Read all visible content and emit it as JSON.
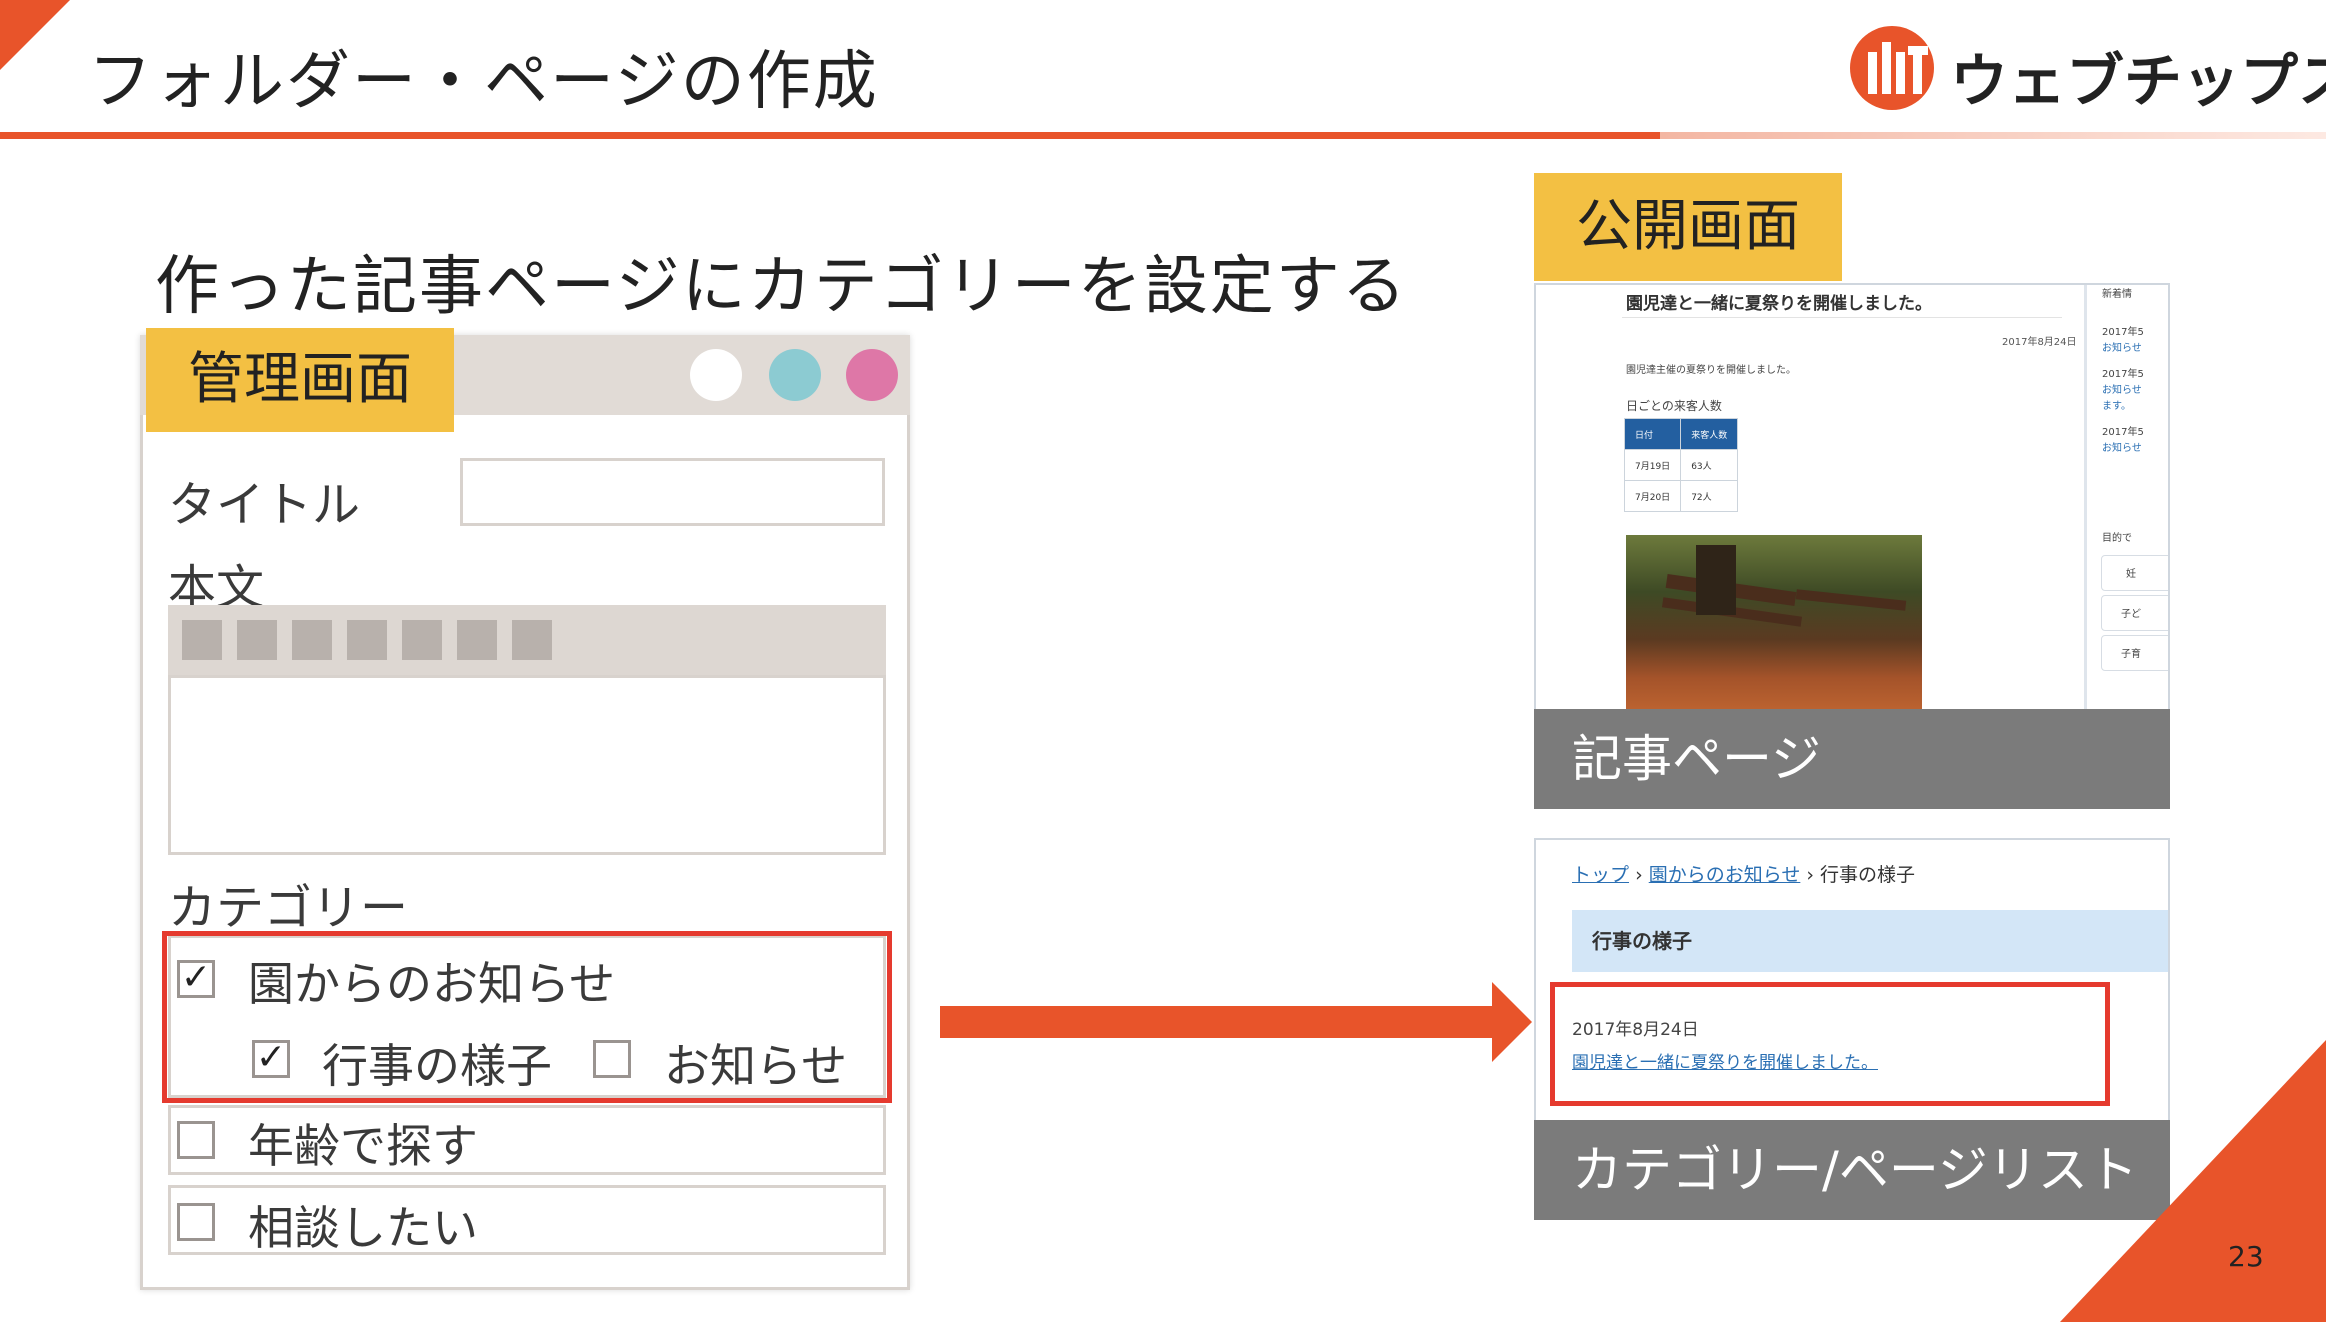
{
  "header": {
    "title": "フォルダー・ページの作成",
    "logo_text": "ウェブチップス"
  },
  "subtitle": "作った記事ページにカテゴリーを設定する",
  "admin": {
    "label": "管理画面",
    "title_label": "タイトル",
    "body_label": "本文",
    "category_label": "カテゴリー",
    "categories": [
      {
        "label": "園からのお知らせ",
        "checked": true
      },
      {
        "label": "行事の様子",
        "checked": true
      },
      {
        "label": "お知らせ",
        "checked": false
      },
      {
        "label": "年齢で探す",
        "checked": false
      },
      {
        "label": "相談したい",
        "checked": false
      }
    ],
    "check_mark": "✓",
    "window_button_colors": [
      "#ffffff",
      "#8ccbd2",
      "#de77a7"
    ]
  },
  "public": {
    "label": "公開画面",
    "article": {
      "title": "園児達と一緒に夏祭りを開催しました。",
      "date": "2017年8月24日",
      "description": "園児達主催の夏祭りを開催しました。",
      "table_heading": "日ごとの来客人数",
      "table_headers": [
        "日付",
        "来客人数"
      ],
      "table_rows": [
        [
          "7月19日",
          "63人"
        ],
        [
          "7月20日",
          "72人"
        ]
      ],
      "sidebar_heading": "新着情",
      "sidebar_items": [
        "2017年5",
        "お知らせ",
        "2017年5",
        "お知らせ",
        "ます。",
        "2017年5",
        "お知らせ"
      ],
      "sidebar_section": "目的で",
      "sidebar_buttons": [
        "妊",
        "子ど",
        "子育"
      ],
      "caption": "記事ページ"
    },
    "list": {
      "breadcrumb": [
        "トップ",
        "園からのお知らせ",
        "行事の様子"
      ],
      "breadcrumb_sep": "›",
      "category_title": "行事の様子",
      "item_date": "2017年8月24日",
      "item_link": "園児達と一緒に夏祭りを開催しました。",
      "caption": "カテゴリー/ページリスト"
    }
  },
  "page_number": "23",
  "colors": {
    "accent": "#e8542a",
    "label_yellow": "#f3c043",
    "highlight_red": "#e53a2e",
    "caption_gray": "#7b7b7b"
  }
}
